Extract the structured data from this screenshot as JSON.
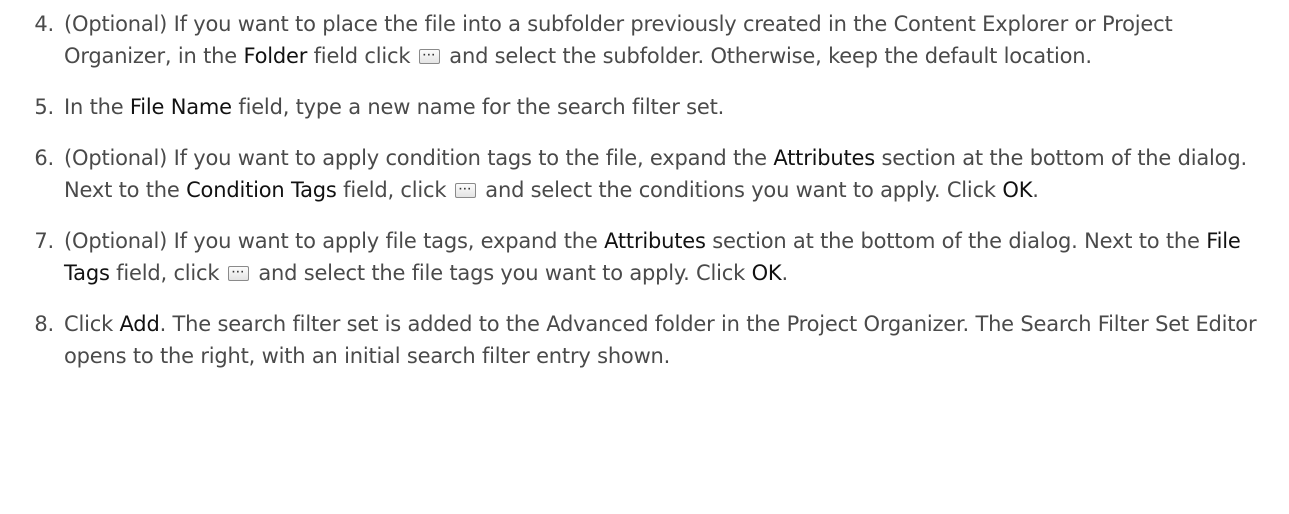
{
  "steps": [
    {
      "number": "4.",
      "text_a": "(Optional) If you want to place the file into a subfolder previously created in the Content Explorer or Project Organizer, in the ",
      "ui_1": "Folder",
      "text_b": " field click",
      "text_c": " and select the subfolder. Otherwise, keep the default location."
    },
    {
      "number": "5.",
      "text_a": "In the ",
      "ui_1": "File Name",
      "text_b": " field, type a new name for the search filter set."
    },
    {
      "number": "6.",
      "text_a": "(Optional) If you want to apply condition tags to the file, expand the ",
      "ui_1": "Attributes",
      "text_b": " section at the bottom of the dialog. Next to the ",
      "ui_2": "Condition Tags",
      "text_c": " field, click",
      "text_d": " and select the conditions you want to apply. Click ",
      "ui_3": "OK",
      "text_e": "."
    },
    {
      "number": "7.",
      "text_a": "(Optional) If you want to apply file tags, expand the ",
      "ui_1": "Attributes",
      "text_b": " section at the bottom of the dialog. Next to the ",
      "ui_2": "File Tags",
      "text_c": " field, click",
      "text_d": " and select the file tags you want to apply. Click ",
      "ui_3": "OK",
      "text_e": "."
    },
    {
      "number": "8.",
      "text_a": "Click ",
      "ui_1": "Add",
      "text_b": ". The search filter set is added to the Advanced folder in the Project Organizer. The Search Filter Set Editor opens to the right, with an initial search filter entry shown."
    }
  ],
  "icons": {
    "browse": "browse-ellipsis-icon"
  }
}
